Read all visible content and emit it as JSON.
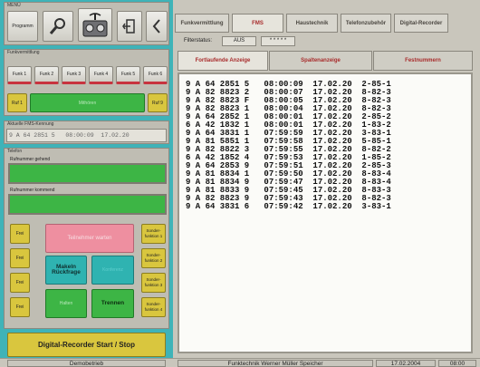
{
  "menu": {
    "group_label": "MENÜ",
    "program_button": "Programm",
    "search_icon": "magnifier-icon",
    "radio_icon": "radio-device-icon",
    "exit_icon": "door-exit-icon",
    "back_icon": "chevron-left-icon"
  },
  "funkvermittlung": {
    "group_label": "Funkvermittlung",
    "buttons": [
      "Funk 1",
      "Funk 2",
      "Funk 3",
      "Funk 4",
      "Funk 5",
      "Funk 6"
    ],
    "ruf_left": "Ruf 1",
    "mithoeren": "Mithören",
    "ruf_right": "Ruf 9"
  },
  "fms_kennung": {
    "group_label": "Aktuelle FMS-Kennung",
    "value": "9 A 64 2851 5   08:00:09  17.02.20"
  },
  "telefon": {
    "group_label": "Telefon",
    "ruhe_gehend_label": "Rufnummer gehend",
    "ruhe_kommend_label": "Rufnummer kommend",
    "frei_labels": [
      "Frei",
      "Frei",
      "Frei",
      "Frei"
    ],
    "sonder_labels": [
      "Sonder-funktion 1",
      "Sonder-funktion 2",
      "Sonder-funktion 3",
      "Sonder-funktion 4"
    ],
    "warteschleife": "Teilnehmer warten",
    "makeln": "Makeln Rückfrage",
    "konferenz": "Konferenz",
    "halten": "Halten",
    "trennen": "Trennen"
  },
  "recorder_button": "Digital-Recorder Start / Stop",
  "tabs": [
    "Funkvermittlung",
    "FMS",
    "Haustechnik",
    "Telefonzubehör",
    "Digital-Recorder"
  ],
  "active_tab": "FMS",
  "filter": {
    "label": "Filterstatus:",
    "value": "AUS",
    "extra": "* * * * *"
  },
  "subtabs": [
    "Fortlaufende Anzeige",
    "Spaltenanzeige",
    "Festnummern"
  ],
  "fms_rows": [
    "9 A 64 2851 5   08:00:09  17.02.20  2-85-1",
    "9 A 82 8823 2   08:00:07  17.02.20  8-82-3",
    "9 A 82 8823 F   08:00:05  17.02.20  8-82-3",
    "9 A 82 8823 1   08:00:04  17.02.20  8-82-3",
    "9 A 64 2852 1   08:00:01  17.02.20  2-85-2",
    "6 A 42 1832 1   08:00:01  17.02.20  1-83-2",
    "9 A 64 3831 1   07:59:59  17.02.20  3-83-1",
    "9 A 81 5851 1   07:59:58  17.02.20  5-85-1",
    "9 A 82 8822 3   07:59:55  17.02.20  8-82-2",
    "6 A 42 1852 4   07:59:53  17.02.20  1-85-2",
    "9 A 64 2853 9   07:59:51  17.02.20  2-85-3",
    "9 A 81 8834 1   07:59:50  17.02.20  8-83-4",
    "9 A 81 8834 9   07:59:47  17.02.20  8-83-4",
    "9 A 81 8833 9   07:59:45  17.02.20  8-83-3",
    "9 A 82 8823 9   07:59:43  17.02.20  8-82-3",
    "9 A 64 3831 6   07:59:42  17.02.20  3-83-1"
  ],
  "status_bar": {
    "mode": "Demobetrieb",
    "company": "Funktechnik Werner Müller Speicher",
    "date": "17.02.2004",
    "time": "08:00"
  },
  "colors": {
    "teal_frame": "#3fb3b8",
    "green": "#3db545",
    "yellow": "#d9c63e",
    "pink": "#ee8fa0",
    "tab_active_text": "#a82b2b"
  }
}
